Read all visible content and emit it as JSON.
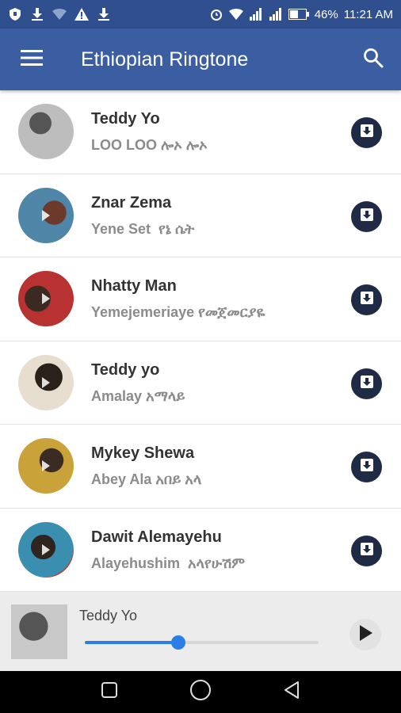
{
  "status_bar": {
    "battery": "46%",
    "time": "11:21 AM",
    "icons_left": [
      "shield-icon",
      "download-icon",
      "wifi-off-icon",
      "warning-icon",
      "download-icon"
    ],
    "icons_right": [
      "alarm-icon",
      "wifi-icon",
      "signal-icon",
      "signal-icon",
      "battery-icon"
    ]
  },
  "app_bar": {
    "title": "Ethiopian Ringtone",
    "menu_icon": "menu-icon",
    "search_icon": "search-icon",
    "color": "#3b5ea3"
  },
  "songs": [
    {
      "artist": "Teddy Yo",
      "title": "LOO LOO ሎኦ ሎኦ",
      "avatar_color": "#bdbdbd"
    },
    {
      "artist": "Znar Zema",
      "title": "Yene Set  የኔ ሴት",
      "avatar_color": "#4f86a8"
    },
    {
      "artist": "Nhatty Man",
      "title": "Yemejemeriaye የመጀመርያዬ",
      "avatar_color": "#8a2a2a"
    },
    {
      "artist": " Teddy yo",
      "title": "Amalay አማላይ",
      "avatar_color": "#3a3024"
    },
    {
      "artist": "Mykey Shewa",
      "title": "Abey Ala አበይ አላ",
      "avatar_color": "#c9a23a"
    },
    {
      "artist": "Dawit Alemayehu",
      "title": "Alayehushim  አላየሁሽም",
      "avatar_color": "#3a8fb0"
    }
  ],
  "player": {
    "title": "Teddy Yo",
    "progress": 0.4,
    "play_icon": "play-icon"
  },
  "nav_bar": {
    "buttons": [
      "recent-apps-icon",
      "home-icon",
      "back-icon"
    ]
  }
}
